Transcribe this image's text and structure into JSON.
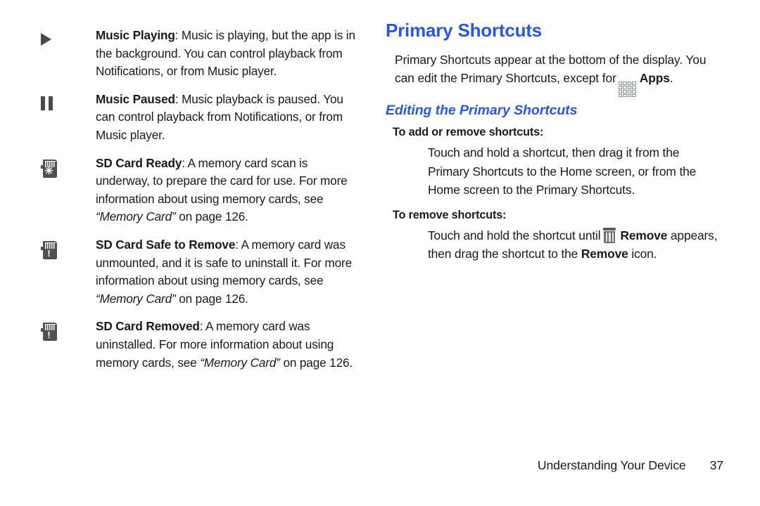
{
  "document": {
    "type": "user-manual-page",
    "accent_color": "#2b55e8",
    "text_color": "#1a1a1a",
    "background_color": "#ffffff"
  },
  "left_column": {
    "items": [
      {
        "icon": "play-icon",
        "term": "Music Playing",
        "text": ": Music is playing, but the app is in the background. You can control playback from Notifications, or from Music player."
      },
      {
        "icon": "pause-icon",
        "term": "Music Paused",
        "text": ": Music playback is paused. You can control playback from Notifications, or from Music player."
      },
      {
        "icon": "sd-card-ready-icon",
        "term": "SD Card Ready",
        "text_1": ": A memory card scan is underway, to prepare the card for use. For more information about using memory cards, see ",
        "italic": "“Memory Card”",
        "text_2": " on page 126."
      },
      {
        "icon": "sd-card-safe-to-remove-icon",
        "term": "SD Card Safe to Remove",
        "text_1": ": A memory card was unmounted, and it is safe to uninstall it. For more information about using memory cards, see ",
        "italic": "“Memory Card”",
        "text_2": " on page 126."
      },
      {
        "icon": "sd-card-removed-icon",
        "term": "SD Card Removed",
        "text_1": ": A memory card was uninstalled. For more information about using memory cards, see ",
        "italic": "“Memory Card”",
        "text_2": " on page 126."
      }
    ]
  },
  "right_column": {
    "heading": "Primary Shortcuts",
    "intro_before_icon": "Primary Shortcuts appear at the bottom of the display. You can edit the Primary Shortcuts, except for",
    "apps_icon_label": "Apps",
    "intro_after_icon": ".",
    "subheading": "Editing the Primary Shortcuts",
    "add_remove": {
      "heading": "To add or remove shortcuts:",
      "body": "Touch and hold a shortcut, then drag it from the Primary Shortcuts to the Home screen, or from the Home screen to the Primary Shortcuts."
    },
    "remove": {
      "heading": "To remove shortcuts:",
      "body_before_icon": "Touch and hold the shortcut until",
      "remove_label_1": "Remove",
      "body_middle": "appears, then drag the shortcut to the",
      "remove_label_2": "Remove",
      "body_after": "icon."
    }
  },
  "footer": {
    "section_title": "Understanding Your Device",
    "page_number": "37"
  }
}
